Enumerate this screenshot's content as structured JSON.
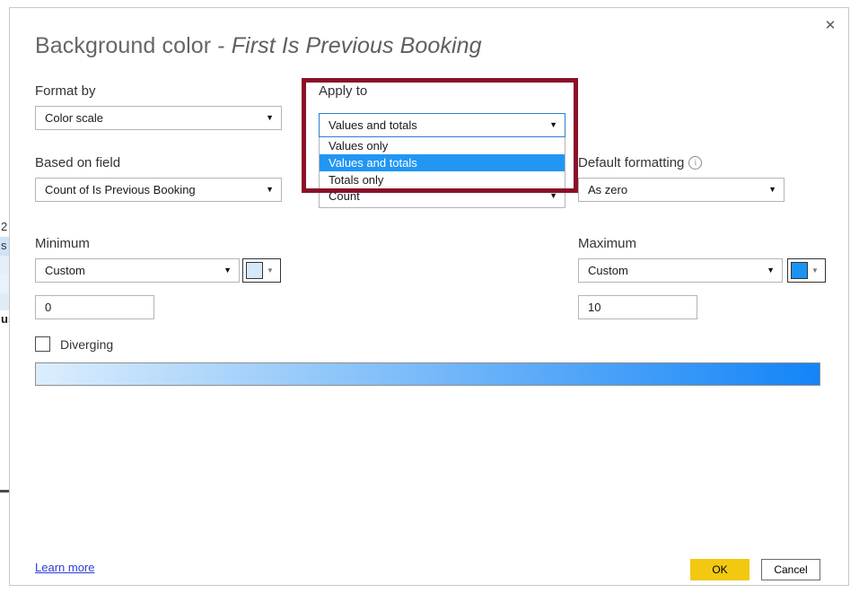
{
  "background": {
    "fragments": [
      {
        "text": "2"
      },
      {
        "text": "s"
      },
      {
        "text": ""
      },
      {
        "text": ""
      },
      {
        "text": ""
      },
      {
        "text": "us"
      }
    ]
  },
  "dialog": {
    "title_prefix": "Background color - ",
    "title_field": "First Is Previous Booking",
    "close_icon": "close-icon"
  },
  "format_by": {
    "label": "Format by",
    "value": "Color scale",
    "caret": "▼"
  },
  "based_on_field": {
    "label": "Based on field",
    "value": "Count of Is Previous Booking",
    "caret": "▼"
  },
  "apply_to": {
    "label": "Apply to",
    "value": "Values and totals",
    "caret": "▼",
    "options": [
      "Values only",
      "Values and totals",
      "Totals only"
    ],
    "selected_index": 1,
    "highlight_color": "#2196f3"
  },
  "summarization": {
    "value": "Count",
    "caret": "▼"
  },
  "default_formatting": {
    "label": "Default formatting",
    "info_icon": "info-icon",
    "info_glyph": "i",
    "value": "As zero",
    "caret": "▼"
  },
  "minimum": {
    "label": "Minimum",
    "mode": "Custom",
    "caret": "▼",
    "value": "0",
    "color": "#d4e9f9",
    "swatch_caret": "▼"
  },
  "maximum": {
    "label": "Maximum",
    "mode": "Custom",
    "caret": "▼",
    "value": "10",
    "color": "#1b93f5",
    "swatch_caret": "▼"
  },
  "diverging": {
    "label": "Diverging",
    "checked": false
  },
  "gradient_preview": {
    "from": "#dceefc",
    "to": "#1384f7"
  },
  "annotation": {
    "color": "#8b1028"
  },
  "footer": {
    "learn_more": "Learn more",
    "ok": "OK",
    "cancel": "Cancel"
  }
}
